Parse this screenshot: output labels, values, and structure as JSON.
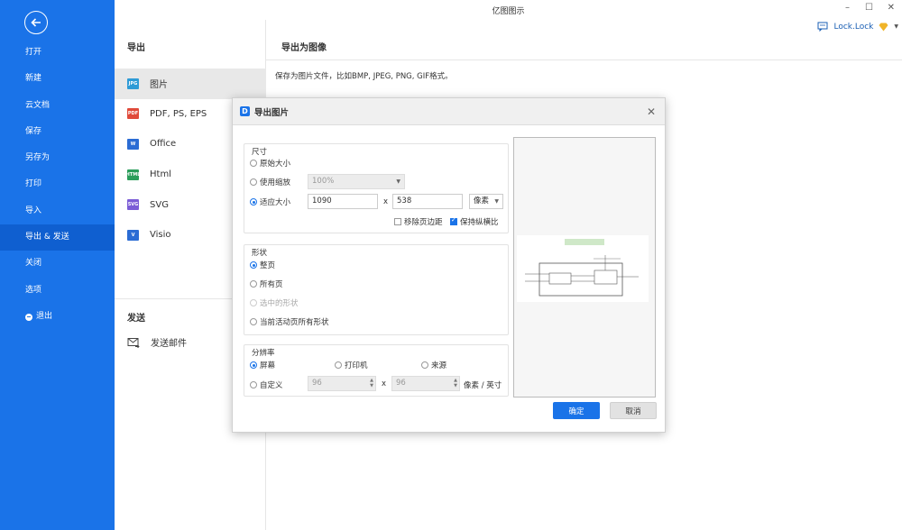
{
  "app": {
    "title": "亿图图示"
  },
  "user": {
    "name": "Lock.Lock"
  },
  "sidebar": {
    "items": [
      {
        "label": "打开"
      },
      {
        "label": "新建"
      },
      {
        "label": "云文档"
      },
      {
        "label": "保存"
      },
      {
        "label": "另存为"
      },
      {
        "label": "打印"
      },
      {
        "label": "导入"
      },
      {
        "label": "导出 & 发送",
        "active": true
      },
      {
        "label": "关闭"
      },
      {
        "label": "选项"
      },
      {
        "label": "退出"
      }
    ]
  },
  "export_panel": {
    "heading": "导出",
    "formats": [
      {
        "label": "图片",
        "icon": "JPG",
        "color": "#2e9bd6"
      },
      {
        "label": "PDF, PS, EPS",
        "icon": "PDF",
        "color": "#e04a3a"
      },
      {
        "label": "Office",
        "icon": "W",
        "color": "#2b6cd4"
      },
      {
        "label": "Html",
        "icon": "HTML",
        "color": "#2a9d5a"
      },
      {
        "label": "SVG",
        "icon": "SVG",
        "color": "#7b5cd6"
      },
      {
        "label": "Visio",
        "icon": "V",
        "color": "#2b6cd4"
      }
    ],
    "send_heading": "发送",
    "send_mail": "发送邮件"
  },
  "main": {
    "heading": "导出为图像",
    "description": "保存为图片文件，比如BMP, JPEG, PNG, GIF格式。"
  },
  "dialog": {
    "title": "导出图片",
    "size": {
      "label": "尺寸",
      "original": "原始大小",
      "use_scale": "使用缩放",
      "scale_value": "100%",
      "fit_size": "适应大小",
      "width": "1090",
      "times": "x",
      "height": "538",
      "unit": "像素",
      "remove_margin": "移除页边距",
      "keep_ratio": "保持纵横比"
    },
    "shape": {
      "label": "形状",
      "whole_page": "整页",
      "all_pages": "所有页",
      "selected": "选中的形状",
      "current_page_all": "当前活动页所有形状"
    },
    "resolution": {
      "label": "分辨率",
      "screen": "屏幕",
      "printer": "打印机",
      "source": "来源",
      "custom": "自定义",
      "dpi_x": "96",
      "times": "x",
      "dpi_y": "96",
      "unit": "像素 / 英寸"
    },
    "ok": "确定",
    "cancel": "取消"
  }
}
